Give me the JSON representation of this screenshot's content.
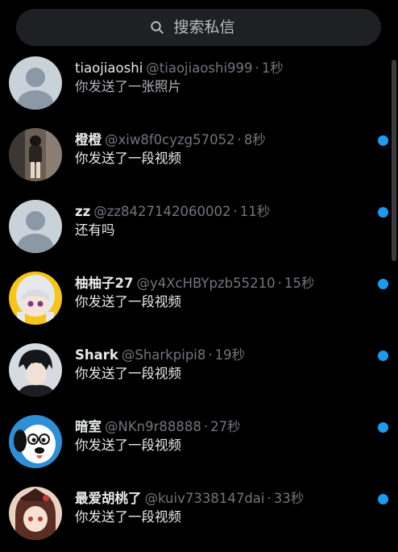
{
  "search": {
    "placeholder": "搜索私信"
  },
  "conversations": [
    {
      "name": "tiaojiaoshi",
      "handle": "@tiaojiaoshi999",
      "time": "1秒",
      "preview": "你发送了一张照片",
      "unread": false,
      "avatar": "default-avatar"
    },
    {
      "name": "橙橙",
      "handle": "@xiw8f0cyzg57052",
      "time": "8秒",
      "preview": "你发送了一段视频",
      "unread": true,
      "avatar": "photo-avatar"
    },
    {
      "name": "zz",
      "handle": "@zz8427142060002",
      "time": "11秒",
      "preview": "还有吗",
      "unread": true,
      "avatar": "default-avatar"
    },
    {
      "name": "柚柚子27",
      "handle": "@y4XcHBYpzb55210",
      "time": "15秒",
      "preview": "你发送了一段视频",
      "unread": true,
      "avatar": "anime-girl-avatar"
    },
    {
      "name": "Shark",
      "handle": "@Sharkpipi8",
      "time": "19秒",
      "preview": "你发送了一段视频",
      "unread": true,
      "avatar": "anime-boy-avatar"
    },
    {
      "name": "暗室",
      "handle": "@NKn9r88888",
      "time": "27秒",
      "preview": "你发送了一段视频",
      "unread": true,
      "avatar": "cartoon-dog-avatar"
    },
    {
      "name": "最爱胡桃了",
      "handle": "@kuiv7338147dai",
      "time": "33秒",
      "preview": "你发送了一段视频",
      "unread": true,
      "avatar": "anime-character-avatar"
    }
  ],
  "colors": {
    "accent": "#1d9bf0",
    "background": "#000000",
    "muted": "#71767b"
  }
}
